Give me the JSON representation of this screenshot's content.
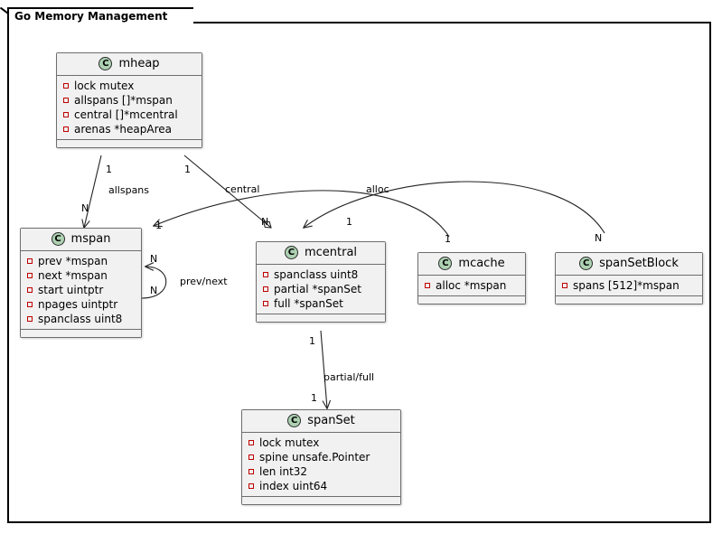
{
  "frame": {
    "title": "Go Memory Management"
  },
  "classes": [
    {
      "id": "mheap",
      "name": "mheap",
      "icon": "class-icon",
      "icon_letter": "C",
      "fields": [
        "lock mutex",
        "allspans []*mspan",
        "central []*mcentral",
        "arenas *heapArea"
      ]
    },
    {
      "id": "mspan",
      "name": "mspan",
      "icon": "class-icon",
      "icon_letter": "C",
      "fields": [
        "prev *mspan",
        "next *mspan",
        "start uintptr",
        "npages uintptr",
        "spanclass uint8"
      ]
    },
    {
      "id": "mcentral",
      "name": "mcentral",
      "icon": "class-icon",
      "icon_letter": "C",
      "fields": [
        "spanclass uint8",
        "partial *spanSet",
        "full *spanSet"
      ]
    },
    {
      "id": "mcache",
      "name": "mcache",
      "icon": "class-icon",
      "icon_letter": "C",
      "fields": [
        "alloc *mspan"
      ]
    },
    {
      "id": "spanSetBlock",
      "name": "spanSetBlock",
      "icon": "class-icon",
      "icon_letter": "C",
      "fields": [
        "spans [512]*mspan"
      ]
    },
    {
      "id": "spanSet",
      "name": "spanSet",
      "icon": "class-icon",
      "icon_letter": "C",
      "fields": [
        "lock mutex",
        "spine unsafe.Pointer",
        "len int32",
        "index uint64"
      ]
    }
  ],
  "relations": [
    {
      "id": "mheap-allspans-mspan",
      "from": "mheap",
      "to": "mspan",
      "label": "allspans",
      "from_mult": "1",
      "to_mult": "N"
    },
    {
      "id": "mheap-central-mcentral",
      "from": "mheap",
      "to": "mcentral",
      "label": "central",
      "from_mult": "1",
      "to_mult": "N"
    },
    {
      "id": "mcache-alloc-mspan",
      "from": "mcache",
      "to": "mspan",
      "label": "alloc",
      "from_mult": "1",
      "to_mult": "1"
    },
    {
      "id": "spanSetBlock-mspan",
      "from": "spanSetBlock",
      "to": "mspan",
      "label": "",
      "from_mult": "N",
      "to_mult": "1"
    },
    {
      "id": "mspan-prevnext-mspan",
      "from": "mspan",
      "to": "mspan",
      "label": "prev/next",
      "from_mult": "N",
      "to_mult": "N"
    },
    {
      "id": "mcentral-partialfull-spanSet",
      "from": "mcentral",
      "to": "spanSet",
      "label": "partial/full",
      "from_mult": "1",
      "to_mult": "1"
    }
  ],
  "colors": {
    "class_icon_fill": "#ADD1B2",
    "class_bg": "#F1F1F1",
    "class_border": "#6D6D6D",
    "field_bullet": "#C00000",
    "edge": "#222222",
    "frame_border": "#000000"
  }
}
